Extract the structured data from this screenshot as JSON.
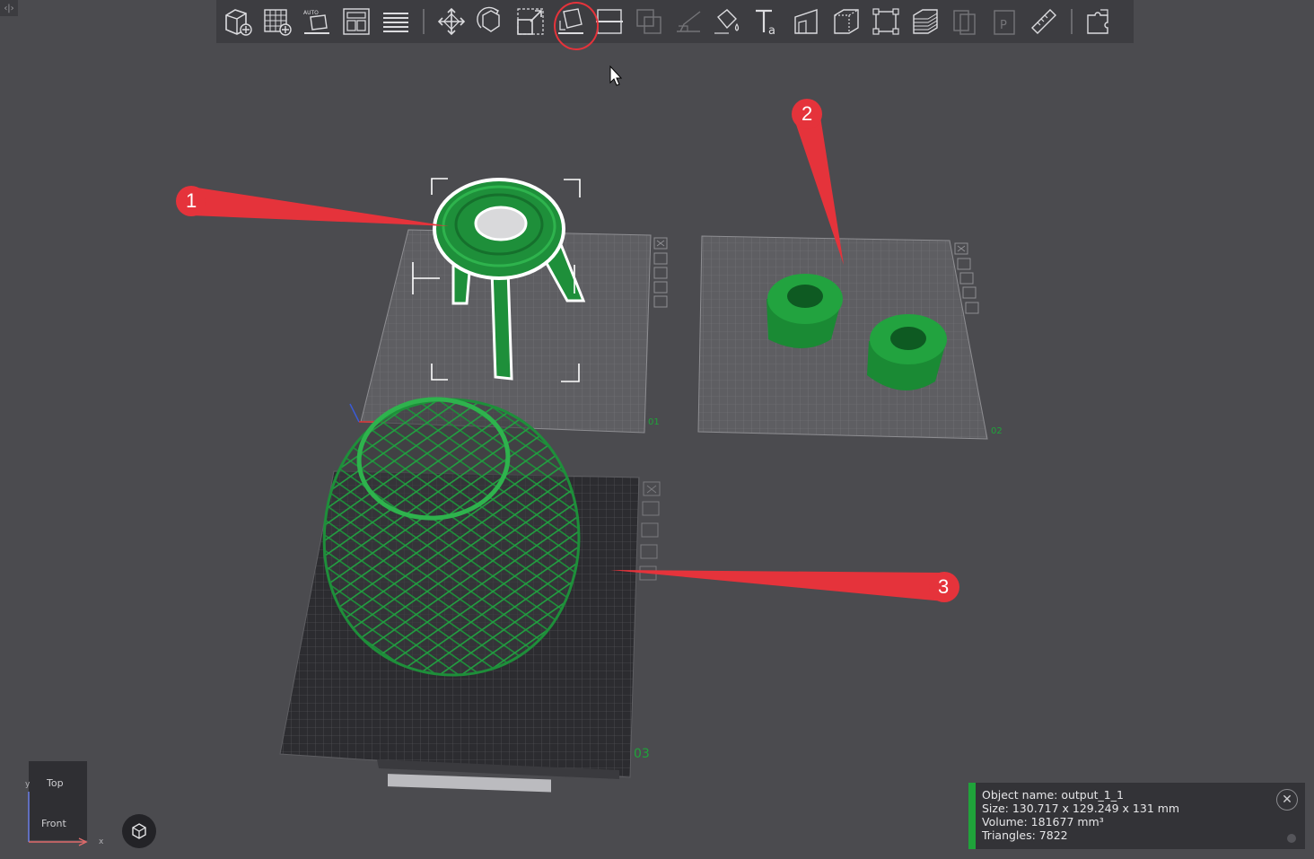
{
  "toolbar": {
    "groups": [
      [
        "add-model",
        "auto-grid",
        "auto-lay-flat",
        "arrange",
        "list-layout"
      ],
      [
        "move",
        "rotate",
        "scale",
        "place-on-face",
        "cut",
        "boolean",
        "support",
        "paint",
        "text",
        "emboss",
        "hollow",
        "bounding-box",
        "layer-slice",
        "copy",
        "paste",
        "measure"
      ],
      [
        "repair"
      ]
    ],
    "active_tool": "place-on-face"
  },
  "plates": [
    {
      "id": "01",
      "label": "01"
    },
    {
      "id": "02",
      "label": "02"
    },
    {
      "id": "03",
      "label": "03"
    }
  ],
  "callouts": [
    "1",
    "2",
    "3"
  ],
  "view_cube": {
    "top": "Top",
    "front": "Front",
    "axis_x": "x",
    "axis_y": "y"
  },
  "object_info": {
    "name": "Object name: output_1_1",
    "size": "Size: 130.717 x 129.249 x 131 mm",
    "volume": "Volume: 181677 mm³",
    "triangles": "Triangles: 7822"
  },
  "colors": {
    "accent_green": "#1fa33a",
    "model_green": "#1e8f3a",
    "callout_red": "#e5333b",
    "bg": "#4b4b4f"
  }
}
